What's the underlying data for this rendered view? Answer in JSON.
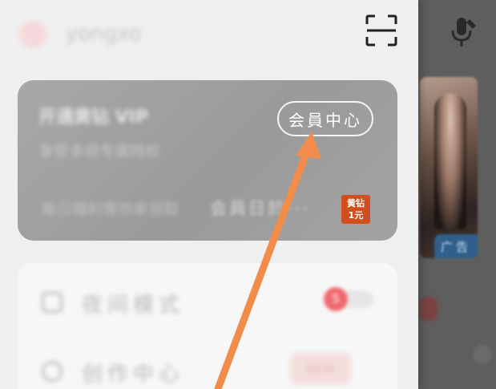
{
  "header": {
    "username": "yongxo",
    "scan_icon": "scan-icon"
  },
  "vip_card": {
    "title": "开通黄钻 VIP",
    "subtitle": "享受多项专属特权",
    "center_button_label": "会員中心",
    "bottom_text": "每日福利等你来领取",
    "daily_label": "会員日於···",
    "promo_badge_line1": "黄钻",
    "promo_badge_line2": "1元"
  },
  "menu": {
    "items": [
      {
        "label": "夜间模式",
        "icon": "moon-icon",
        "badge": "S"
      },
      {
        "label": "创作中心",
        "icon": "edit-icon",
        "tag": "NEW"
      }
    ]
  },
  "background": {
    "ad_badge": "广告",
    "mic_icon": "microphone-icon"
  },
  "colors": {
    "arrow": "#f28c4a",
    "promo": "#d14f1e",
    "toggle_knob": "#ef6a70",
    "ad_badge": "#2f5f8a"
  }
}
